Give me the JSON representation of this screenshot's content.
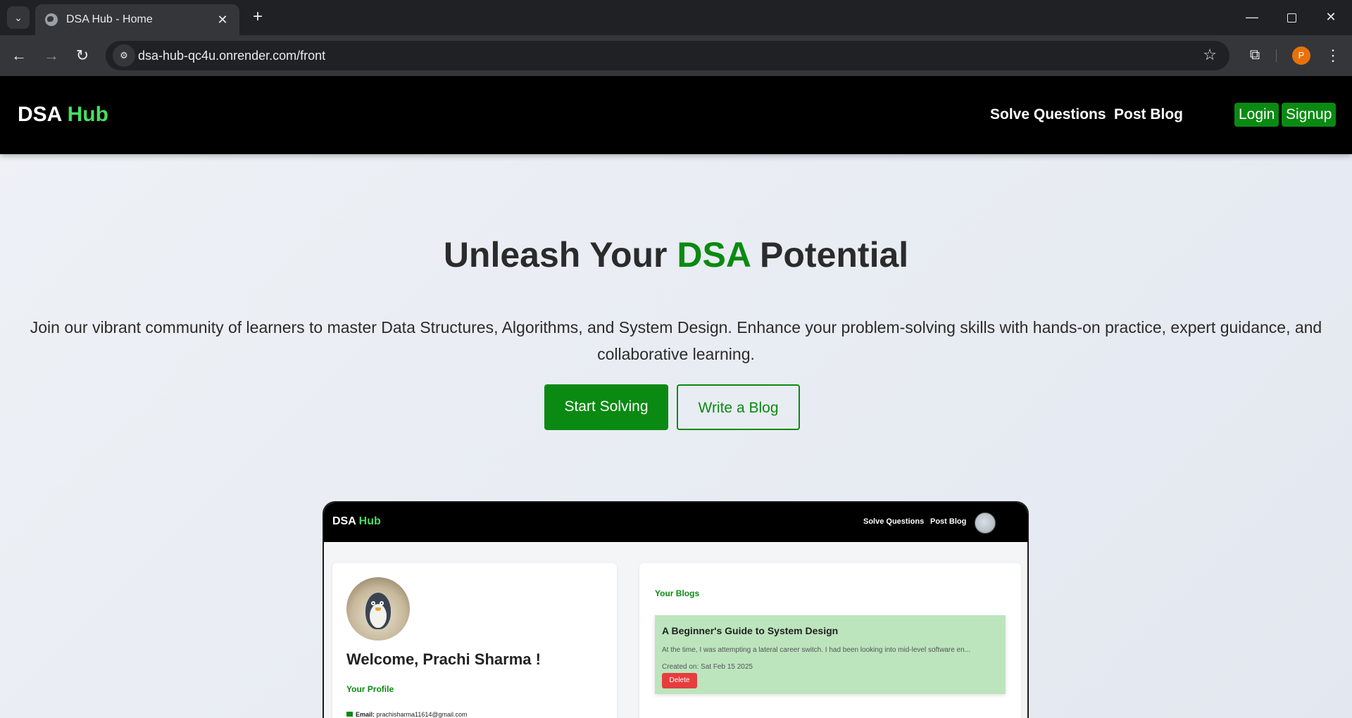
{
  "browser": {
    "tab_title": "DSA Hub - Home",
    "url": "dsa-hub-qc4u.onrender.com/front",
    "profile_initial": "P"
  },
  "site": {
    "logo_main": "DSA",
    "logo_accent": "Hub",
    "nav": {
      "solve": "Solve Questions",
      "post": "Post Blog"
    },
    "auth": {
      "login": "Login",
      "signup": "Signup"
    }
  },
  "hero": {
    "title_pre": "Unleash Your",
    "title_accent": "DSA",
    "title_post": "Potential",
    "description": "Join our vibrant community of learners to master Data Structures, Algorithms, and System Design. Enhance your problem-solving skills with hands-on practice, expert guidance, and collaborative learning.",
    "primary_button": "Start Solving",
    "secondary_button": "Write a Blog"
  },
  "preview": {
    "logo_main": "DSA",
    "logo_accent": "Hub",
    "nav": {
      "solve": "Solve Questions",
      "post": "Post Blog"
    },
    "welcome": "Welcome, Prachi Sharma !",
    "profile_label": "Your Profile",
    "email_label": "Email:",
    "email_value": "prachisharma11614@gmail.com",
    "blogs_label": "Your Blogs",
    "blog": {
      "title": "A Beginner's Guide to System Design",
      "excerpt": "At the time, I was attempting a lateral career switch. I had been looking into mid-level software en...",
      "created": "Created on: Sat Feb 15 2025",
      "delete_label": "Delete"
    }
  },
  "colors": {
    "accent_green": "#0a8a12",
    "logo_green": "#4ade60",
    "delete_red": "#e53e3e",
    "blog_bg": "#bce5bd"
  }
}
